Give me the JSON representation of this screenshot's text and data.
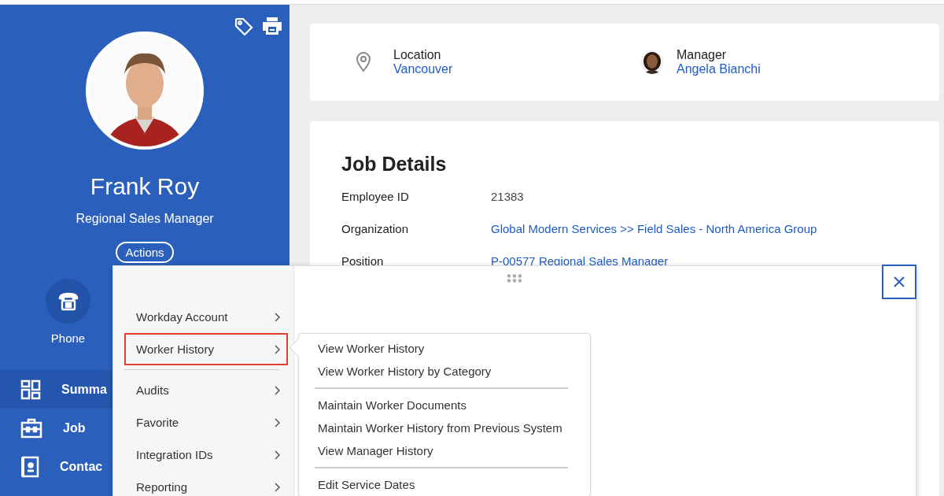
{
  "profile": {
    "name": "Frank Roy",
    "title": "Regional Sales Manager",
    "actions_button": "Actions"
  },
  "quick_actions": [
    {
      "label": "Phone"
    }
  ],
  "nav": [
    {
      "label": "Summa",
      "selected": true
    },
    {
      "label": "Job",
      "selected": false
    },
    {
      "label": "Contac",
      "selected": false
    }
  ],
  "info_card": {
    "location": {
      "label": "Location",
      "value": "Vancouver"
    },
    "manager": {
      "label": "Manager",
      "value": "Angela Bianchi"
    }
  },
  "job_details": {
    "title": "Job Details",
    "rows": [
      {
        "label": "Employee ID",
        "value": "21383",
        "kind": "text"
      },
      {
        "label": "Organization",
        "value": "Global Modern Services >> Field Sales - North America Group",
        "kind": "link"
      },
      {
        "label": "Position",
        "value": "P-00577 Regional Sales Manager",
        "kind": "link"
      }
    ]
  },
  "actions_menu": {
    "groups": [
      [
        {
          "label": "Workday Account",
          "selected": false
        },
        {
          "label": "Worker History",
          "selected": true
        }
      ],
      [
        {
          "label": "Audits",
          "selected": false
        },
        {
          "label": "Favorite",
          "selected": false
        },
        {
          "label": "Integration IDs",
          "selected": false
        },
        {
          "label": "Reporting",
          "selected": false
        }
      ]
    ],
    "submenu": {
      "groups": [
        [
          "View Worker History",
          "View Worker History by Category"
        ],
        [
          "Maintain Worker Documents",
          "Maintain Worker History from Previous System",
          "View Manager History"
        ],
        [
          "Edit Service Dates"
        ]
      ]
    }
  }
}
